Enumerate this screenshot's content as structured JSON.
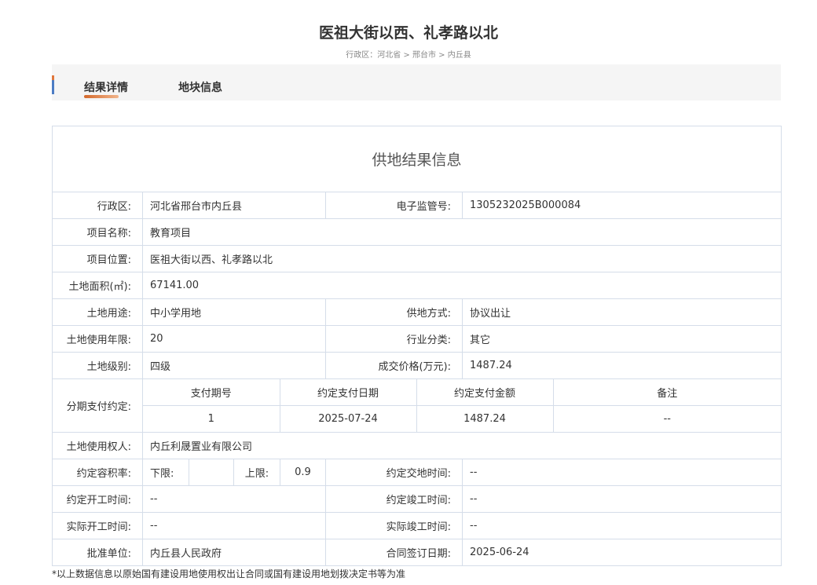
{
  "header": {
    "title": "医祖大街以西、礼孝路以北",
    "breadcrumb": "行政区：河北省 > 邢台市 > 内丘县"
  },
  "tabs": [
    {
      "label": "结果详情",
      "active": true
    },
    {
      "label": "地块信息",
      "active": false
    }
  ],
  "table": {
    "title": "供地结果信息",
    "rows": {
      "district": {
        "label": "行政区:",
        "value": "河北省邢台市内丘县"
      },
      "supervision_no": {
        "label": "电子监管号:",
        "value": "1305232025B000084"
      },
      "project_name": {
        "label": "项目名称:",
        "value": "教育项目"
      },
      "project_location": {
        "label": "项目位置:",
        "value": "医祖大街以西、礼孝路以北"
      },
      "land_area": {
        "label": "土地面积(㎡):",
        "value": "67141.00"
      },
      "land_use": {
        "label": "土地用途:",
        "value": "中小学用地"
      },
      "supply_method": {
        "label": "供地方式:",
        "value": "协议出让"
      },
      "use_term": {
        "label": "土地使用年限:",
        "value": "20"
      },
      "industry": {
        "label": "行业分类:",
        "value": "其它"
      },
      "land_grade": {
        "label": "土地级别:",
        "value": "四级"
      },
      "price": {
        "label": "成交价格(万元):",
        "value": "1487.24"
      },
      "installment": {
        "label": "分期支付约定:",
        "headers": [
          "支付期号",
          "约定支付日期",
          "约定支付金额",
          "备注"
        ],
        "row": [
          "1",
          "2025-07-24",
          "1487.24",
          "--"
        ]
      },
      "land_user": {
        "label": "土地使用权人:",
        "value": "内丘利晟置业有限公司"
      },
      "far": {
        "label": "约定容积率:",
        "lower_label": "下限:",
        "lower_value": "",
        "upper_label": "上限:",
        "upper_value": "0.9"
      },
      "delivery_time": {
        "label": "约定交地时间:",
        "value": "--"
      },
      "start_time_agreed": {
        "label": "约定开工时间:",
        "value": "--"
      },
      "completion_time_agreed": {
        "label": "约定竣工时间:",
        "value": "--"
      },
      "start_time_actual": {
        "label": "实际开工时间:",
        "value": "--"
      },
      "completion_time_actual": {
        "label": "实际竣工时间:",
        "value": "--"
      },
      "approval_unit": {
        "label": "批准单位:",
        "value": "内丘县人民政府"
      },
      "contract_date": {
        "label": "合同签订日期:",
        "value": "2025-06-24"
      }
    }
  },
  "footnote": "*以上数据信息以原始国有建设用地使用权出让合同或国有建设用地划拨决定书等为准",
  "colors": {
    "tab_accent": "#4c7cc4",
    "tab_underline": "#d4692c",
    "border": "#d5dde9"
  }
}
